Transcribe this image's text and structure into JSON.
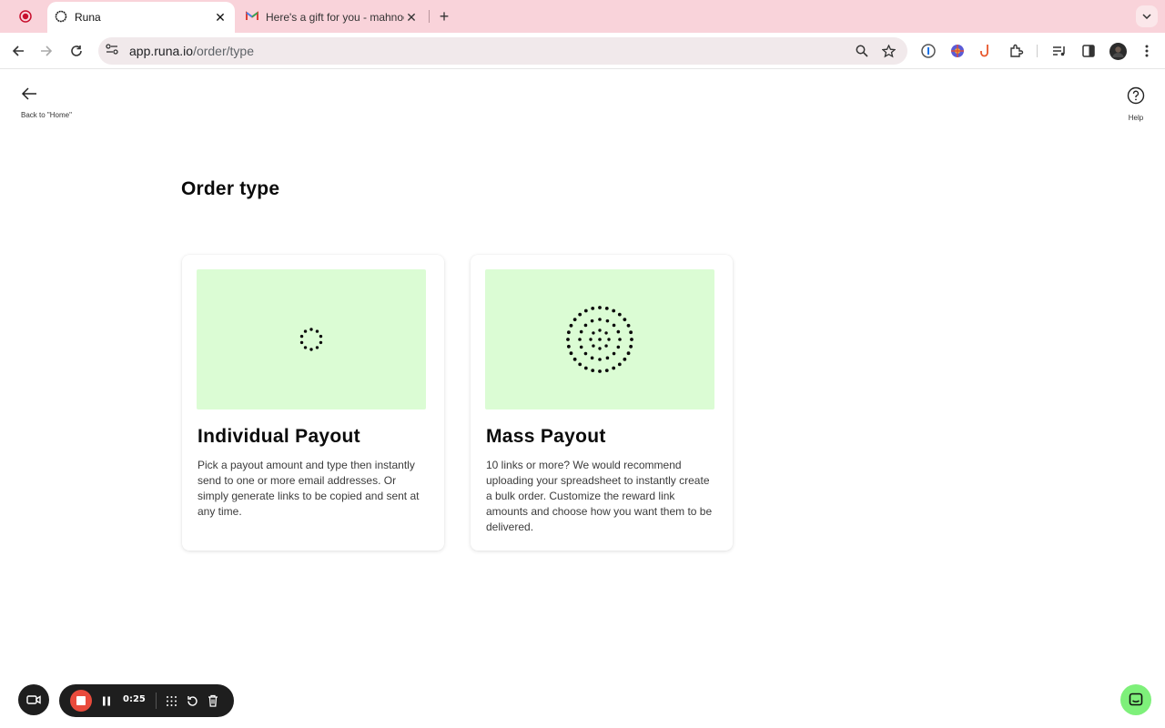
{
  "browser": {
    "tabs": [
      {
        "title": "Runa",
        "active": true,
        "icon": "runa-logo-icon"
      },
      {
        "title": "Here's a gift for you - mahnoo",
        "active": false,
        "icon": "gmail-icon"
      }
    ],
    "url_host": "app.runa.io",
    "url_path": "/order/type"
  },
  "nav": {
    "back_label": "Back to \"Home\"",
    "help_label": "Help"
  },
  "page": {
    "title": "Order type",
    "cards": [
      {
        "title": "Individual Payout",
        "description": "Pick a payout amount and type then instantly send to one or more email addresses. Or simply generate links to be copied and sent at any time.",
        "illustration": "single-dotted-circle"
      },
      {
        "title": "Mass Payout",
        "description": "10 links or more? We would recommend uploading your spreadsheet to instantly create a bulk order. Customize the reward link amounts and choose how you want them to be delivered.",
        "illustration": "concentric-dotted-circles"
      }
    ]
  },
  "recorder": {
    "elapsed": "0:25"
  },
  "colors": {
    "tabstrip": "#f9d3da",
    "card_hero": "#dbfcd4",
    "record_stop": "#e94b3c",
    "chat_button": "#7ef07a"
  }
}
